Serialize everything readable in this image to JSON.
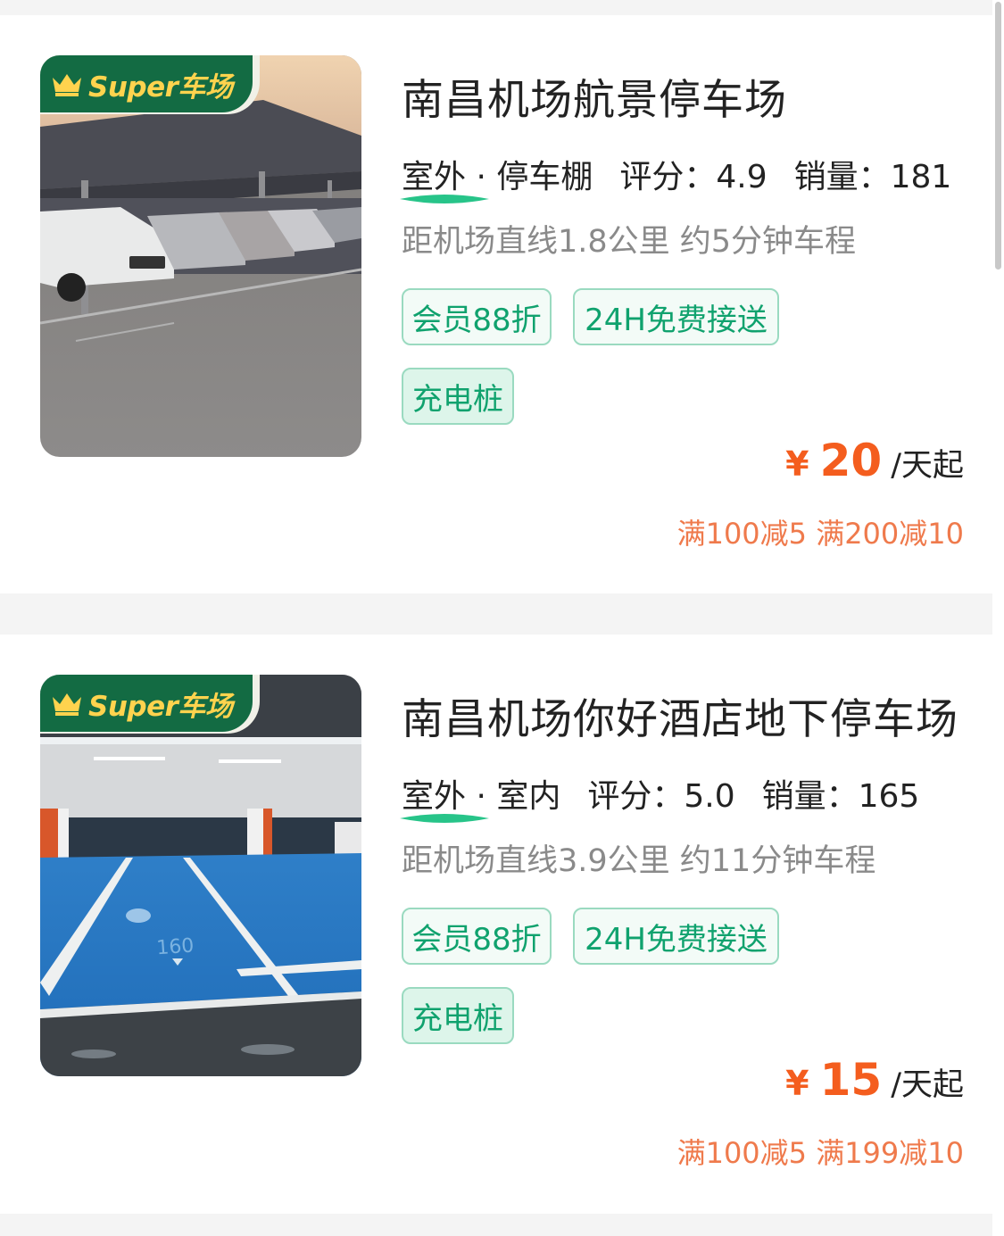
{
  "colors": {
    "badge_green": "#136b43",
    "badge_text": "#ffd34e",
    "tag_green": "#10a26e",
    "price_orange": "#f45d1e",
    "promo_orange": "#ef7a4c"
  },
  "listings": [
    {
      "badge": "Super车场",
      "badge_icon": "crown-icon",
      "image": "parking-shed-photo",
      "title": "南昌机场航景停车场",
      "type": "室外 · 停车棚",
      "rating": "评分：4.9",
      "sales": "销量：181",
      "distance": "距机场直线1.8公里 约5分钟车程",
      "tags": [
        "会员88折",
        "24H免费接送",
        "充电桩"
      ],
      "price_symbol": "¥",
      "price": "20",
      "price_unit": "/天起",
      "promo": "满100减5 满200减10"
    },
    {
      "badge": "Super车场",
      "badge_icon": "crown-icon",
      "image": "underground-garage-photo",
      "title": "南昌机场你好酒店地下停车场",
      "type": "室外 · 室内",
      "rating": "评分：5.0",
      "sales": "销量：165",
      "distance": "距机场直线3.9公里 约11分钟车程",
      "tags": [
        "会员88折",
        "24H免费接送",
        "充电桩"
      ],
      "price_symbol": "¥",
      "price": "15",
      "price_unit": "/天起",
      "promo": "满100减5 满199减10"
    }
  ]
}
